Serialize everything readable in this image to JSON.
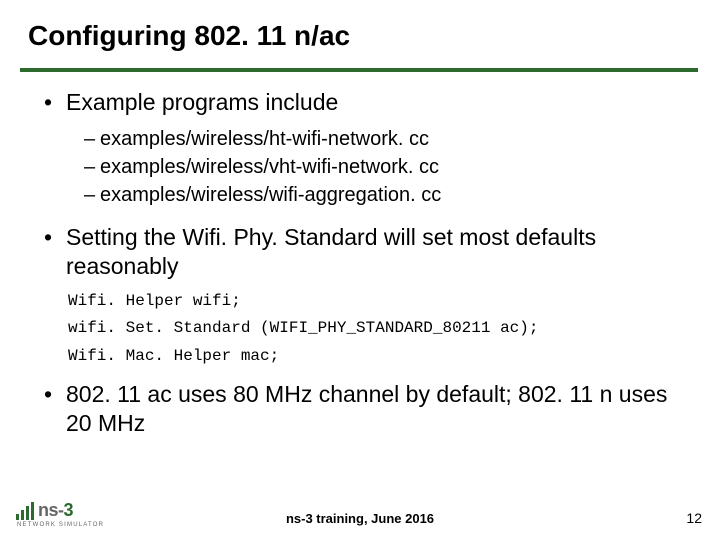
{
  "title": "Configuring 802. 11 n/ac",
  "bullets": {
    "b1": "Example programs include",
    "sub1": "examples/wireless/ht-wifi-network. cc",
    "sub2": "examples/wireless/vht-wifi-network. cc",
    "sub3": "examples/wireless/wifi-aggregation. cc",
    "b2": "Setting the Wifi. Phy. Standard will set most defaults reasonably",
    "code1": "Wifi. Helper wifi;",
    "code2": "wifi. Set. Standard (WIFI_PHY_STANDARD_80211 ac);",
    "code3": "Wifi. Mac. Helper mac;",
    "b3": "802. 11 ac uses 80 MHz channel by default; 802. 11 n uses 20 MHz"
  },
  "footer": {
    "center": "ns-3 training, June 2016",
    "page": "12"
  },
  "logo": {
    "name_prefix": "ns-",
    "name_suffix": "3",
    "sub": "NETWORK SIMULATOR"
  }
}
